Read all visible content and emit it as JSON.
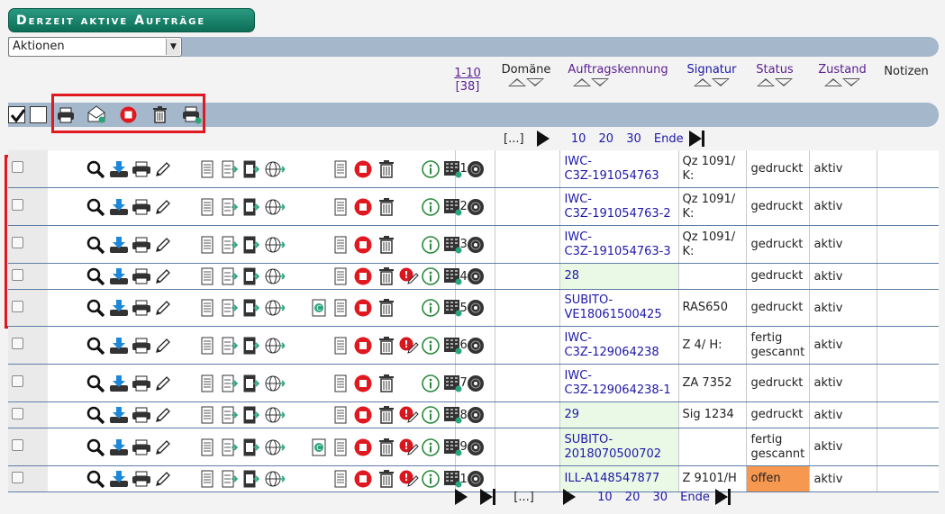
{
  "title": "Derzeit aktive Aufträge",
  "actions": {
    "selected": "Aktionen"
  },
  "columns": {
    "range": "1-10",
    "total": "[38]",
    "domaene": "Domäne",
    "auftragskennung": "Auftragskennung",
    "signatur": "Signatur",
    "status": "Status",
    "zustand": "Zustand",
    "notizen": "Notizen"
  },
  "pager": {
    "ellipsis": "[...]",
    "p10": "10",
    "p20": "20",
    "p30": "30",
    "end": "Ende"
  },
  "colors": {
    "header_green": "#0d6e57",
    "bar_blue": "#a4b7cb",
    "highlight_red": "#e0181f",
    "status_offen": "#f6984f",
    "id_bg_light_green": "#eaf8e6"
  },
  "rows": [
    {
      "num": "1",
      "id": "IWC-\nC3Z-191054763",
      "sig": "Qz 1091/\nK:",
      "status": "gedruckt",
      "zustand": "aktiv",
      "flag": false,
      "copyright": false,
      "id_green": false
    },
    {
      "num": "2",
      "id": "IWC-\nC3Z-191054763-2",
      "sig": "Qz 1091/\nK:",
      "status": "gedruckt",
      "zustand": "aktiv",
      "flag": false,
      "copyright": false,
      "id_green": false
    },
    {
      "num": "3",
      "id": "IWC-\nC3Z-191054763-3",
      "sig": "Qz 1091/\nK:",
      "status": "gedruckt",
      "zustand": "aktiv",
      "flag": false,
      "copyright": false,
      "id_green": false
    },
    {
      "num": "4",
      "id": "28",
      "sig": "",
      "status": "gedruckt",
      "zustand": "aktiv",
      "flag": true,
      "copyright": false,
      "id_green": true
    },
    {
      "num": "5",
      "id": "SUBITO-\nVE18061500425",
      "sig": "RAS650",
      "status": "gedruckt",
      "zustand": "aktiv",
      "flag": false,
      "copyright": true,
      "id_green": false
    },
    {
      "num": "6",
      "id": "IWC-\nC3Z-129064238",
      "sig": "Z 4/ H:",
      "status": "fertig\ngescannt",
      "zustand": "aktiv",
      "flag": true,
      "copyright": false,
      "id_green": false
    },
    {
      "num": "7",
      "id": "IWC-\nC3Z-129064238-1",
      "sig": "ZA 7352",
      "status": "gedruckt",
      "zustand": "aktiv",
      "flag": false,
      "copyright": false,
      "id_green": false
    },
    {
      "num": "8",
      "id": "29",
      "sig": "Sig 1234",
      "status": "gedruckt",
      "zustand": "aktiv",
      "flag": true,
      "copyright": false,
      "id_green": true
    },
    {
      "num": "9",
      "id": "SUBITO-\n2018070500702",
      "sig": "",
      "status": "fertig\ngescannt",
      "zustand": "aktiv",
      "flag": true,
      "copyright": true,
      "id_green": true
    },
    {
      "num": "10",
      "id": "ILL-A148547877",
      "sig": "Z 9101/H",
      "status": "offen",
      "zustand": "aktiv",
      "flag": true,
      "copyright": false,
      "id_green": true
    }
  ]
}
